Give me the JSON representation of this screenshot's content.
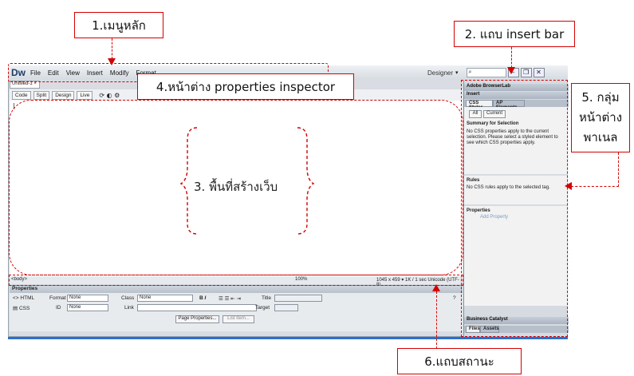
{
  "callouts": {
    "main_menu": "1.เมนูหลัก",
    "insert_bar": "2. แถบ insert bar",
    "page_area": "3. พื้นที่สร้างเว็บ",
    "properties": "4.หน้าต่าง properties inspector",
    "panel_group_1": "5. กลุ่ม",
    "panel_group_2": "หน้าต่าง",
    "panel_group_3": "พาเนล",
    "status_bar": "6.แถบสถานะ"
  },
  "app": {
    "logo": "Dw",
    "menu": [
      "File",
      "Edit",
      "View",
      "Insert",
      "Modify",
      "Format"
    ],
    "workspace": "Designer",
    "window_buttons": [
      "–",
      "❐",
      "✕"
    ]
  },
  "document": {
    "tab": "Untitled-1",
    "view_buttons": [
      "Code",
      "Split",
      "Design",
      "Live"
    ]
  },
  "status": {
    "tag": "<body>",
    "zoom": "100%",
    "info": "1045 x 459 ▾  1K / 1 sec  Unicode (UTF-8)"
  },
  "properties": {
    "title": "Properties",
    "html_label": "HTML",
    "css_label": "CSS",
    "format_label": "Format",
    "format_value": "None",
    "id_label": "ID",
    "id_value": "None",
    "class_label": "Class",
    "class_value": "None",
    "link_label": "Link",
    "title_label": "Title",
    "target_label": "Target",
    "page_props_button": "Page Properties...",
    "list_item_button": "List Item..."
  },
  "panels": {
    "browserlab": "Adobe BrowserLab",
    "insert": "Insert",
    "tab_css": "CSS Styles",
    "tab_ap": "AP Elements",
    "btn_all": "All",
    "btn_current": "Current",
    "summary_title": "Summary for Selection",
    "summary_text_1": "No CSS properties apply to the current",
    "summary_text_2": "selection.  Please select a styled element to",
    "summary_text_3": "see which CSS properties apply.",
    "rules_title": "Rules",
    "rules_text": "No CSS rules apply to the selected tag.",
    "properties_title": "Properties",
    "add_property": "Add Property",
    "business": "Business Catalyst",
    "tab_files": "Files",
    "tab_assets": "Assets"
  }
}
